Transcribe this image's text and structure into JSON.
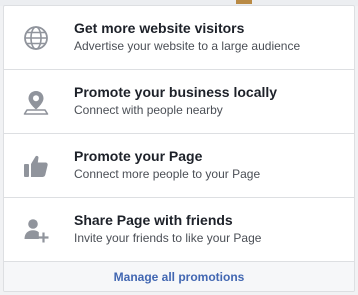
{
  "promotions": {
    "items": [
      {
        "icon": "globe-icon",
        "title": "Get more website visitors",
        "subtitle": "Advertise your website to a large audience"
      },
      {
        "icon": "location-pin-icon",
        "title": "Promote your business locally",
        "subtitle": "Connect with people nearby"
      },
      {
        "icon": "thumbs-up-icon",
        "title": "Promote your Page",
        "subtitle": "Connect more people to your Page"
      },
      {
        "icon": "add-friend-icon",
        "title": "Share Page with friends",
        "subtitle": "Invite your friends to like your Page"
      }
    ],
    "footer_link": "Manage all promotions"
  },
  "colors": {
    "icon_gray": "#90949c",
    "link_blue": "#4267b2",
    "title_text": "#1d2129",
    "subtitle_text": "#4b4f56"
  }
}
